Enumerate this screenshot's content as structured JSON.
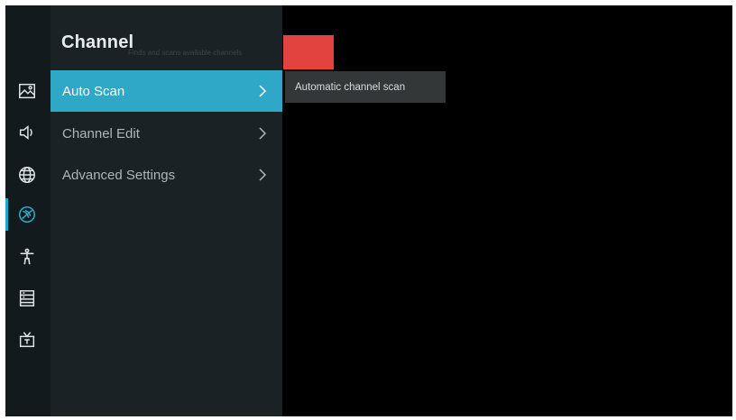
{
  "menu": {
    "title": "Channel",
    "faded_text": "Finds and scans available channels",
    "items": [
      {
        "label": "Auto Scan",
        "selected": true
      },
      {
        "label": "Channel Edit",
        "selected": false
      },
      {
        "label": "Advanced Settings",
        "selected": false
      }
    ]
  },
  "tooltip": {
    "text": "Automatic channel scan"
  },
  "sidebar": {
    "icons": [
      "picture-icon",
      "sound-icon",
      "network-icon",
      "channel-icon",
      "accessibility-icon",
      "system-icon",
      "tv-icon"
    ],
    "active_icon": "channel-icon"
  },
  "colors": {
    "accent": "#2fa7c6",
    "indicator": "#1aa8cc",
    "red_block": "#e3433f"
  }
}
